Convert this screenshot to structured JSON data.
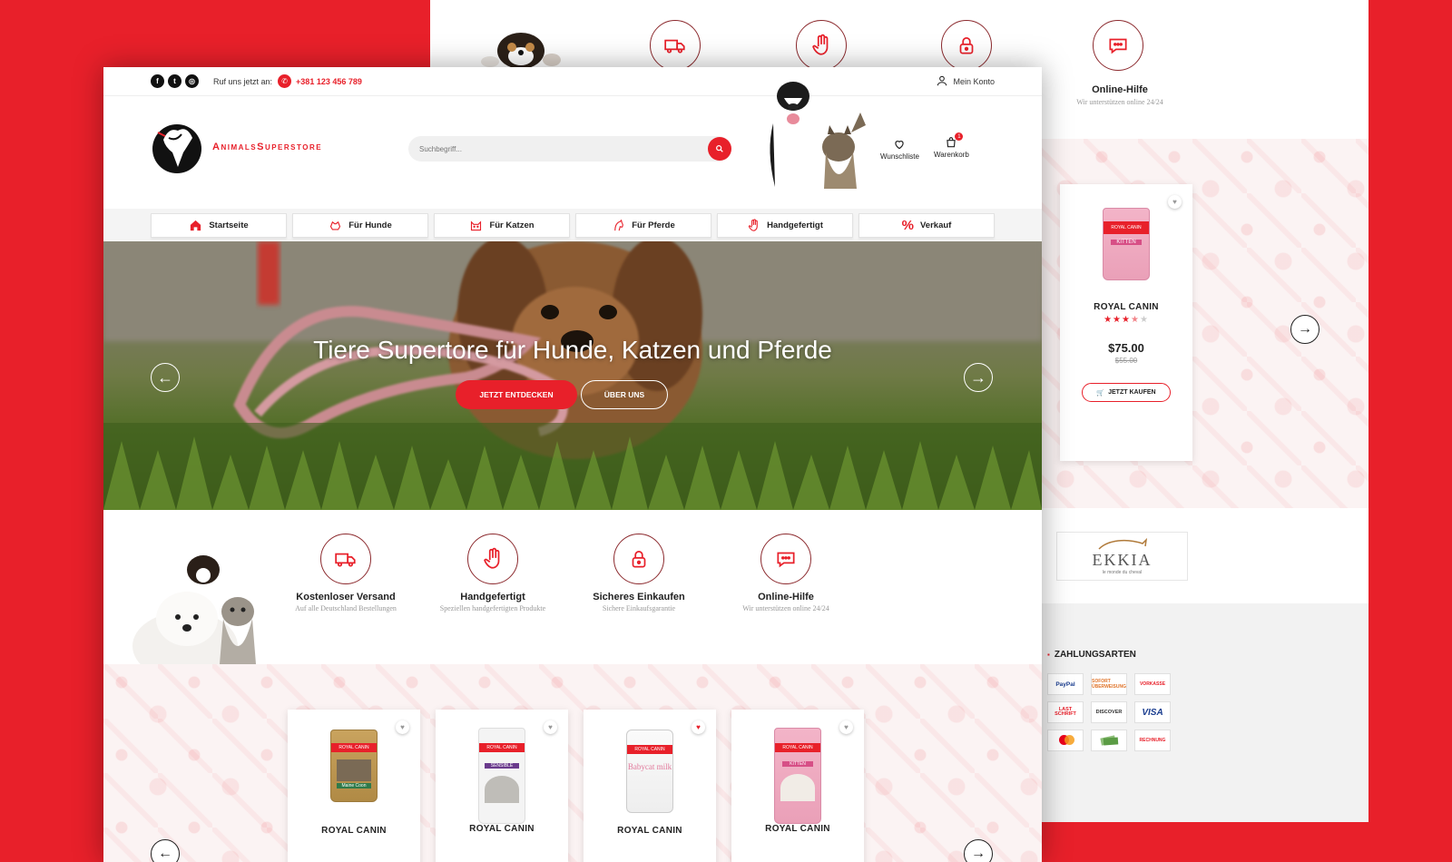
{
  "topbar": {
    "call_label": "Ruf uns jetzt an:",
    "phone": "+381 123 456 789",
    "account": "Mein Konto"
  },
  "logo": {
    "text": "AnimalsSuperstore"
  },
  "search": {
    "placeholder": "Suchbegriff..."
  },
  "header": {
    "wishlist": "Wunschliste",
    "cart": "Warenkorb",
    "cart_count": "1"
  },
  "nav": {
    "items": [
      "Startseite",
      "Für Hunde",
      "Für Katzen",
      "Für Pferde",
      "Handgefertigt",
      "Verkauf"
    ]
  },
  "hero": {
    "headline": "Tiere Supertore für Hunde, Katzen und Pferde",
    "primary_btn": "JETZT ENTDECKEN",
    "secondary_btn": "ÜBER UNS"
  },
  "features": [
    {
      "title": "Kostenloser Versand",
      "subtitle": "Auf alle Deutschland Bestellungen",
      "icon": "truck-icon"
    },
    {
      "title": "Handgefertigt",
      "subtitle": "Speziellen handgefertigten Produkte",
      "icon": "hand-icon"
    },
    {
      "title": "Sicheres Einkaufen",
      "subtitle": "Sichere Einkaufsgarantie",
      "icon": "lock-icon"
    },
    {
      "title": "Online-Hilfe",
      "subtitle": "Wir unterstützen online 24/24",
      "icon": "chat-icon"
    }
  ],
  "products": [
    {
      "brand": "ROYAL CANIN",
      "label": "Maine Coon"
    },
    {
      "brand": "ROYAL CANIN",
      "label": "SENSIBLE"
    },
    {
      "brand": "ROYAL CANIN",
      "label": "Babycat milk"
    },
    {
      "brand": "ROYAL CANIN",
      "label": "KITTEN"
    }
  ],
  "back": {
    "feature_title": "Online-Hilfe",
    "feature_sub": "Wir unterstützen online 24/24",
    "product": {
      "brand": "ROYAL CANIN",
      "label": "KITTEN",
      "price": "$75.00",
      "old_price": "$55.00",
      "button": "JETZT KAUFEN",
      "rating": 3.5,
      "rating_max": 5
    },
    "partner": "EKKIA",
    "partner_sub": "le monde du cheval",
    "payments_title": "ZAHLUNGSARTEN",
    "payments": [
      "PayPal",
      "SOFORT ÜBERWEISUNG",
      "VORKASSE",
      "LAST SCHRIFT",
      "DISCOVER",
      "VISA",
      "mastercard",
      "",
      "RECHNUNG"
    ]
  },
  "colors": {
    "accent": "#e8202a",
    "dark": "#222222"
  }
}
